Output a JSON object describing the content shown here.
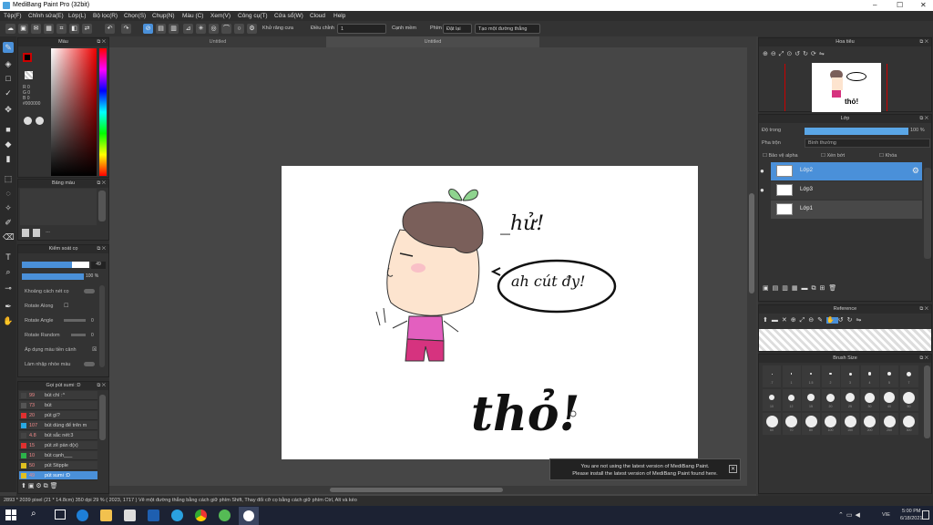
{
  "window": {
    "title": "MediBang Paint Pro (32bit)",
    "minimize": "–",
    "maximize": "☐",
    "close": "✕"
  },
  "menu": [
    "Tệp(F)",
    "Chỉnh sửa(E)",
    "Lớp(L)",
    "Bộ lọc(R)",
    "Chọn(S)",
    "Chụp(N)",
    "Màu (C)",
    "Xem(V)",
    "Công cụ(T)",
    "Cửa sổ(W)",
    "Cloud",
    "Help"
  ],
  "toolbar": {
    "antialias": "Khử răng cưa",
    "adjust_label": "Điều chỉnh",
    "adjust_value": "1",
    "edge": "Cạnh mềm",
    "key_label": "Phím",
    "restore": "Đặt lại",
    "create_line": "Tạo một đường thẳng"
  },
  "documents": {
    "tab1": "Untitled",
    "tab2": "Untitled"
  },
  "color_panel": {
    "title": "Màu",
    "r": "R 0",
    "g": "G 0",
    "b": "B 0",
    "hex": "#000000"
  },
  "color_table": {
    "title": "Bảng màu",
    "dash": "---"
  },
  "brush_control": {
    "title": "Kiểm soát cọ",
    "size_value": "49",
    "opacity_value": "100 %",
    "options": [
      {
        "label": "Khoảng cách nét cọ"
      },
      {
        "label": "Rotate Along",
        "check": "☐"
      },
      {
        "label": "Rotate Angle",
        "value": "0"
      },
      {
        "label": "Rotate Random",
        "value": "0"
      },
      {
        "label": "Áp dụng màu tiền cảnh",
        "check": "☒"
      },
      {
        "label": "Làm nhập nhòe màu"
      }
    ]
  },
  "brush_list": {
    "title": "Gọi pút sumi :D",
    "items": [
      {
        "size": "99",
        "name": "bút chì :^",
        "color": "#444444"
      },
      {
        "size": "73",
        "name": "bút",
        "color": "#555555"
      },
      {
        "size": "20",
        "name": "pút gì?",
        "color": "#e03030"
      },
      {
        "size": "107",
        "name": "bút dùng để trên m",
        "color": "#29a8e0"
      },
      {
        "size": "4.8",
        "name": "bút sắc nét:3",
        "color": "#444444"
      },
      {
        "size": "15",
        "name": "pút zẽ pàn d(x)",
        "color": "#e03030"
      },
      {
        "size": "10",
        "name": "bút cạnh___",
        "color": "#2cb34a"
      },
      {
        "size": "50",
        "name": "pút Stipple",
        "color": "#e0c020"
      },
      {
        "size": "49",
        "name": "pút sumi :D",
        "color": "#e0c020"
      }
    ]
  },
  "navigator": {
    "title": "Hoa tiêu"
  },
  "layer_panel": {
    "title": "Lớp",
    "opacity_label": "Độ trong",
    "opacity_value": "100 %",
    "blend_label": "Pha trộn",
    "blend_value": "Bình thường",
    "protect_alpha": "Bảo vệ alpha",
    "clipping": "Xén bớt",
    "lock": "Khóa",
    "layers": [
      {
        "name": "Lớp2"
      },
      {
        "name": "Lớp3"
      },
      {
        "name": "Lớp1"
      }
    ]
  },
  "reference": {
    "title": "Reference"
  },
  "brush_size": {
    "title": "Brush Size",
    "row1": [
      ".7",
      "1",
      "1.5",
      "2",
      "3",
      "4",
      "5",
      "7"
    ],
    "row2": [
      "10",
      "12",
      "15",
      "20",
      "25",
      "30",
      "40",
      "50"
    ],
    "row3": [
      "60",
      "70",
      "80",
      "100",
      "150",
      "200",
      "250",
      "300"
    ]
  },
  "artwork": {
    "speech1": "_hử!",
    "speech2": "ah cút đy!",
    "big": "thỏ!"
  },
  "notification": {
    "line1": "You are not using the latest version of MediBang Paint.",
    "line2": "Please install the latest version of MediBang Paint found here."
  },
  "status": {
    "text": "2893 * 2039 pixel  (21 * 14.8cm)  350 dpi  29 %  ( 2023, 1717 )  Vẽ một đường thẳng bằng cách giữ phím Shift, Thay đổi cỡ cọ bằng cách giữ phím Ctrl, Alt và kéo"
  },
  "taskbar": {
    "lang": "VIE",
    "time": "5:00 PM",
    "date": "6/18/2021"
  },
  "colors": {
    "accent": "#4a90d9",
    "layer_selected": "#4a90d9"
  }
}
